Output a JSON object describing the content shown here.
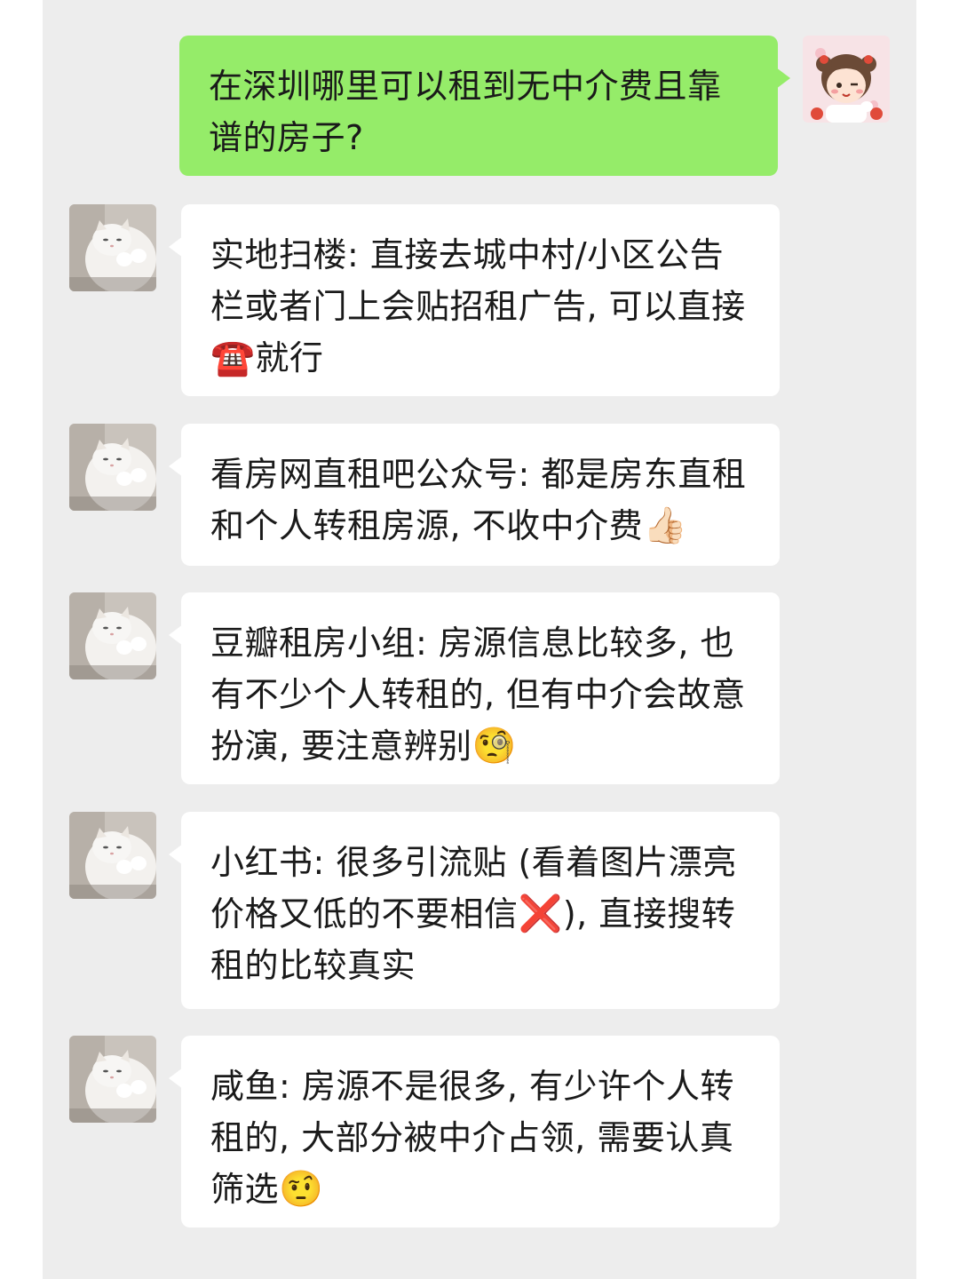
{
  "conversation": {
    "question": "在深圳哪里可以租到无中介费且靠谱的房子?",
    "replies": [
      {
        "text": "实地扫楼: 直接去城中村/小区公告栏或者门上会贴招租广告, 可以直接",
        "emoji": "☎️",
        "text_after": "就行"
      },
      {
        "text": "看房网直租吧公众号: 都是房东直租和个人转租房源, 不收中介费",
        "emoji": "👍🏻",
        "text_after": ""
      },
      {
        "text": "豆瓣租房小组: 房源信息比较多, 也有不少个人转租的, 但有中介会故意扮演, 要注意辨别",
        "emoji": "🧐",
        "text_after": ""
      },
      {
        "text": "小红书: 很多引流贴 (看着图片漂亮价格又低的不要相信",
        "emoji": "❌",
        "text_after": "), 直接搜转租的比较真实"
      },
      {
        "text": "咸鱼: 房源不是很多, 有少许个人转租的, 大部分被中介占领, 需要认真筛选",
        "emoji": "🤨",
        "text_after": ""
      }
    ]
  },
  "colors": {
    "chat_background": "#ededed",
    "my_bubble": "#95ec69",
    "other_bubble": "#ffffff"
  },
  "icons": {
    "my_avatar": "cartoon-girl-avatar",
    "other_avatar": "white-cat-avatar"
  }
}
